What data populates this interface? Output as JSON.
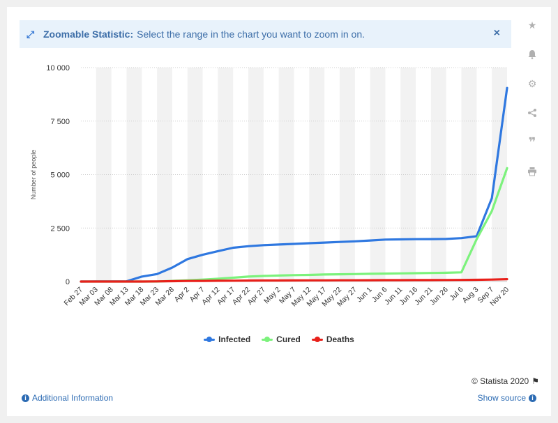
{
  "banner": {
    "title": "Zoomable Statistic:",
    "text": "Select the range in the chart you want to zoom in on.",
    "close": "×"
  },
  "sidebar": {
    "icons": [
      "star-icon",
      "bell-icon",
      "gear-icon",
      "share-icon",
      "quote-icon",
      "print-icon"
    ]
  },
  "footer": {
    "copyright": "© Statista 2020",
    "additional_info": "Additional Information",
    "show_source": "Show source"
  },
  "colors": {
    "infected": "#2f78e0",
    "cured": "#7cf27c",
    "deaths": "#e8201a"
  },
  "chart_data": {
    "type": "line",
    "title": "",
    "xlabel": "",
    "ylabel": "Number of people",
    "ylim": [
      0,
      10000
    ],
    "yticks": [
      0,
      2500,
      5000,
      7500,
      10000
    ],
    "ytick_labels": [
      "0",
      "2 500",
      "5 000",
      "7 500",
      "10 000"
    ],
    "grid": true,
    "legend_position": "bottom",
    "x_tick_labels": [
      "Feb 27",
      "Mar 03",
      "Mar 08",
      "Mar 13",
      "Mar 18",
      "Mar 23",
      "Mar 28",
      "Apr 2",
      "Apr 7",
      "Apr 12",
      "Apr 17",
      "Apr 22",
      "Apr 27",
      "May 2",
      "May 7",
      "May 12",
      "May 17",
      "May 22",
      "May 27",
      "Jun 1",
      "Jun 6",
      "Jun 11",
      "Jun 16",
      "Jun 21",
      "Jun 26",
      "Jul 6",
      "Aug 3",
      "Sep 7",
      "Nov 20"
    ],
    "series": [
      {
        "name": "Infected",
        "color_key": "infected",
        "values": [
          0,
          2,
          5,
          10,
          230,
          350,
          650,
          1050,
          1250,
          1420,
          1580,
          1650,
          1700,
          1730,
          1760,
          1790,
          1820,
          1850,
          1880,
          1920,
          1960,
          1970,
          1980,
          1985,
          1990,
          2030,
          2120,
          3900,
          9050
        ]
      },
      {
        "name": "Cured",
        "color_key": "cured",
        "values": [
          0,
          0,
          0,
          0,
          0,
          0,
          30,
          60,
          90,
          130,
          180,
          230,
          260,
          280,
          300,
          310,
          330,
          340,
          350,
          360,
          370,
          380,
          390,
          400,
          410,
          430,
          1980,
          3300,
          5300
        ]
      },
      {
        "name": "Deaths",
        "color_key": "deaths",
        "values": [
          0,
          0,
          0,
          0,
          0,
          5,
          15,
          25,
          30,
          35,
          40,
          45,
          48,
          50,
          52,
          54,
          56,
          58,
          60,
          62,
          64,
          66,
          68,
          70,
          72,
          75,
          80,
          90,
          110
        ]
      }
    ]
  }
}
